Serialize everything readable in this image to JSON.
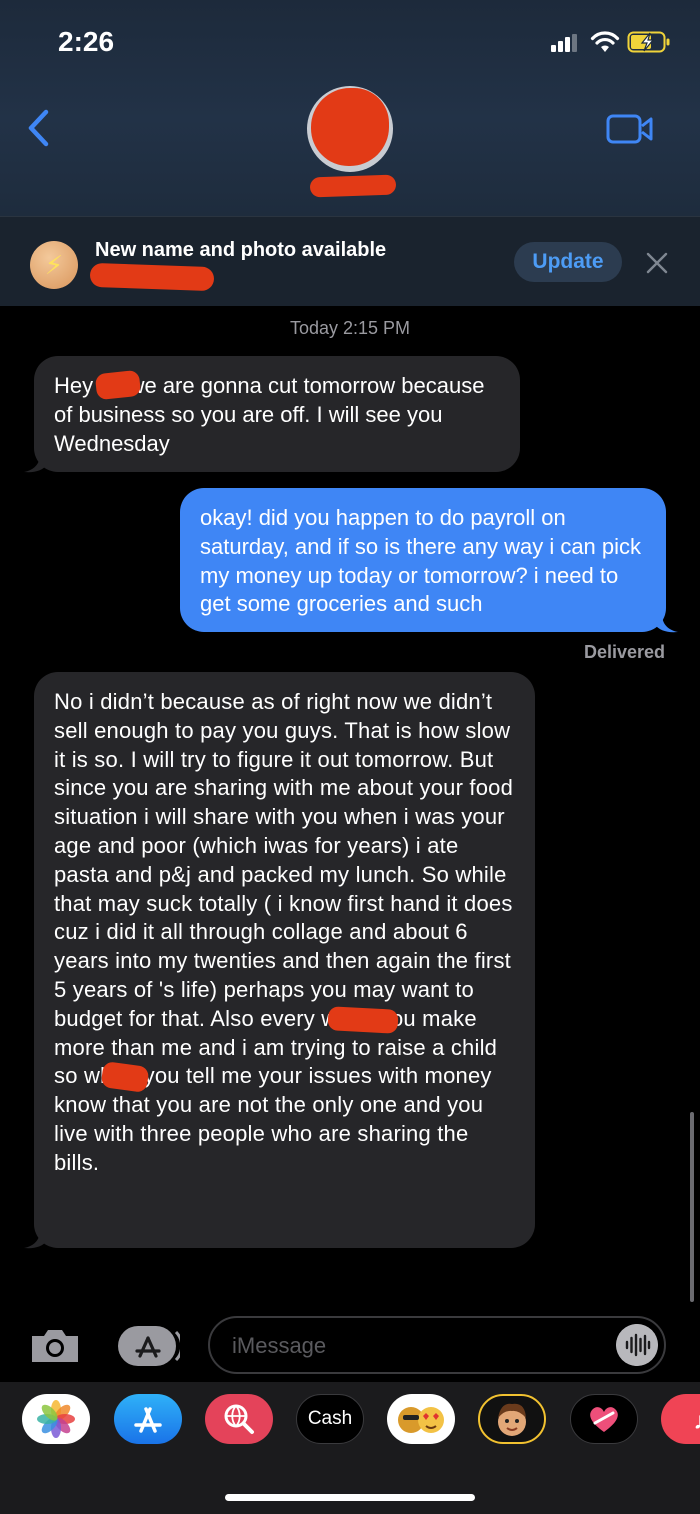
{
  "status_bar": {
    "time": "2:26"
  },
  "banner": {
    "title": "New name and photo available",
    "update_label": "Update"
  },
  "thread": {
    "timestamp": "Today 2:15 PM",
    "messages": [
      {
        "direction": "incoming",
        "text": "Hey      so we are gonna cut tomorrow because of business so you are off. I will see you Wednesday"
      },
      {
        "direction": "outgoing",
        "text": "okay! did you happen to do payroll on saturday, and if so is there any way i can pick my money up today or tomorrow? i need to get some groceries and such"
      },
      {
        "direction": "incoming",
        "text": "No i didn’t because as of right now we didn’t sell enough to pay you guys.   That is how slow it is so.  I will try to figure it out tomorrow.  But since you are sharing with me about your food situation i will share with you when i was your age and poor (which iwas for years) i ate pasta and p&j and packed my lunch.  So while that may suck totally ( i know first hand it does cuz i did it all through collage and about 6 years into my twenties and then again the first  5 years of       's life) perhaps you may want to budget for that.  Also       every week you make more than me and i am trying to raise a child so when you tell me your issues with money know that you are not the only one and you live with three people who are sharing the bills."
      }
    ],
    "delivered_label": "Delivered"
  },
  "composer": {
    "placeholder": "iMessage"
  },
  "app_drawer": {
    "items": [
      {
        "name": "photos-app-icon"
      },
      {
        "name": "app-store-icon"
      },
      {
        "name": "images-search-icon"
      },
      {
        "name": "apple-cash-icon",
        "label": "Cash"
      },
      {
        "name": "animoji-icon"
      },
      {
        "name": "memoji-icon"
      },
      {
        "name": "digital-touch-icon"
      },
      {
        "name": "music-icon"
      }
    ]
  },
  "colors": {
    "accent": "#3f86f5",
    "incoming_bubble": "#262629",
    "header_bg": "#223247",
    "redaction": "#e23a16"
  }
}
